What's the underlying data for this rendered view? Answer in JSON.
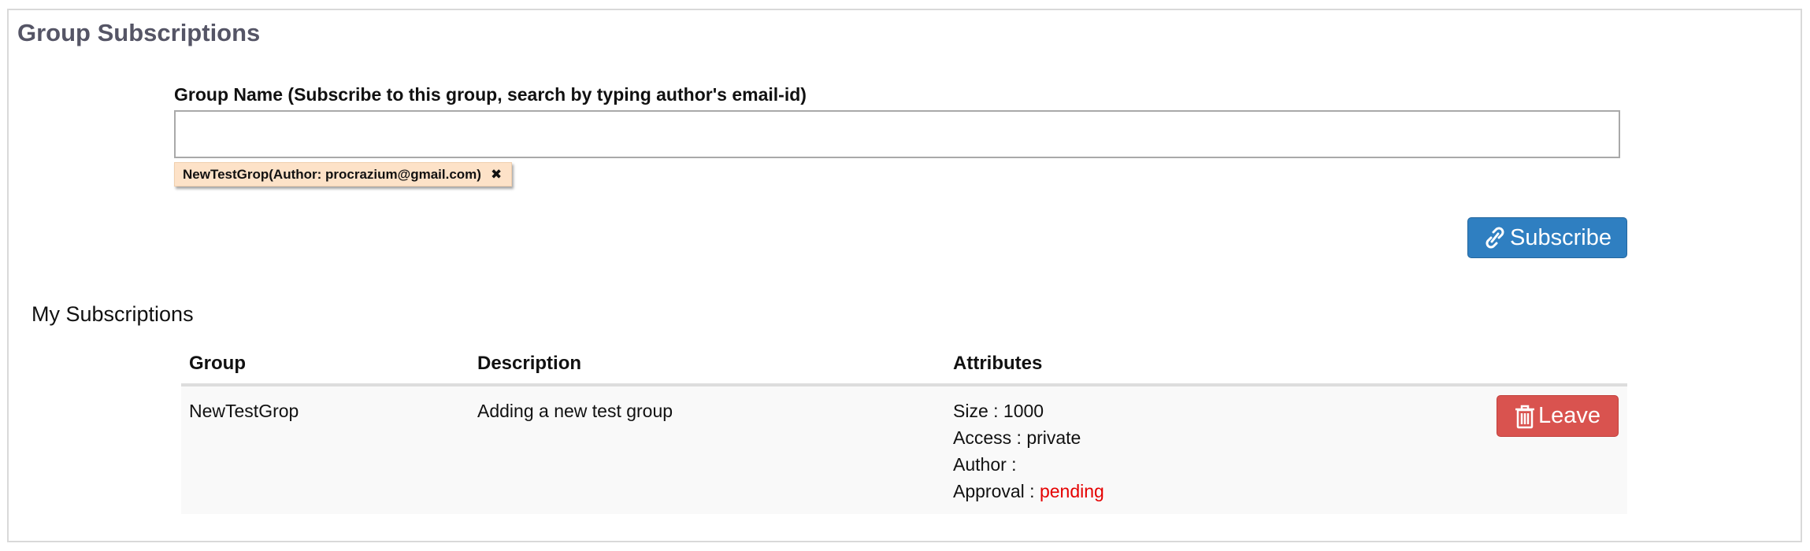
{
  "panel": {
    "title": "Group Subscriptions"
  },
  "subscribe_form": {
    "label": "Group Name (Subscribe to this group, search by typing author's email-id)",
    "input_value": "",
    "selected_tag": "NewTestGrop(Author: procrazium@gmail.com)",
    "tag_remove_glyph": "✖",
    "subscribe_label": "Subscribe",
    "subscribe_icon": "link-icon"
  },
  "my_subscriptions": {
    "heading": "My Subscriptions",
    "columns": [
      "Group",
      "Description",
      "Attributes",
      ""
    ],
    "rows": [
      {
        "group": "NewTestGrop",
        "description": "Adding a new test group",
        "size_label": "Size : ",
        "size_value": "1000",
        "access_label": "Access : ",
        "access_value": "private",
        "author_label": "Author : ",
        "author_value": "",
        "approval_label": "Approval : ",
        "approval_value": "pending",
        "leave_label": "Leave",
        "leave_icon": "trash-icon"
      }
    ]
  },
  "colors": {
    "primary_button": "#2f7fc1",
    "danger_button": "#d9534f",
    "pending_status": "#e50000",
    "tag_background": "#fde2c8",
    "title_text": "#555566"
  }
}
